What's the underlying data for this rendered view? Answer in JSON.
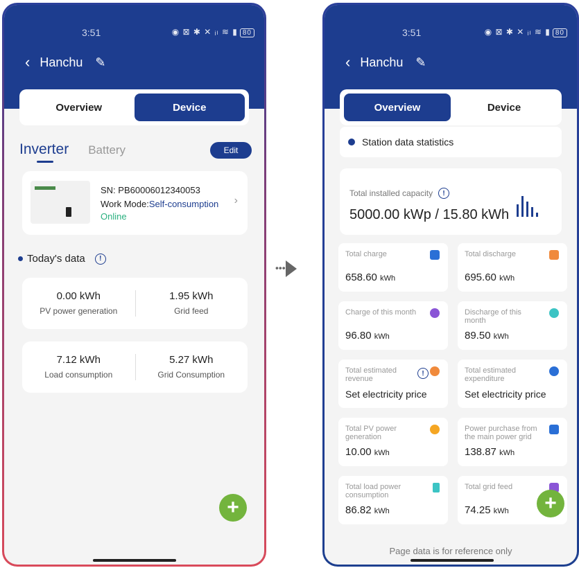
{
  "left": {
    "status": {
      "time": "3:51",
      "icons": "◉ ⊠ ✱ ✕ ᵢₗ ≋ ▮",
      "battery": "80"
    },
    "nav": {
      "back": "‹",
      "title": "Hanchu",
      "edit_icon": "✎"
    },
    "segment": {
      "overview": "Overview",
      "device": "Device"
    },
    "tabs": {
      "inverter": "Inverter",
      "battery": "Battery",
      "edit": "Edit"
    },
    "inverter": {
      "sn": "SN: PB60006012340053",
      "work_mode_label": "Work Mode:",
      "work_mode": "Self-consumption",
      "status": "Online"
    },
    "today": {
      "title": "Today's data"
    },
    "stats": [
      {
        "value": "0.00 kWh",
        "label": "PV power generation"
      },
      {
        "value": "1.95 kWh",
        "label": "Grid feed"
      },
      {
        "value": "7.12 kWh",
        "label": "Load consumption"
      },
      {
        "value": "5.27 kWh",
        "label": "Grid Consumption"
      }
    ],
    "fab": "+"
  },
  "arrow": "•••",
  "right": {
    "status": {
      "time": "3:51",
      "icons": "◉ ⊠ ✱ ✕ ᵢₗ ≋ ▮",
      "battery": "80"
    },
    "nav": {
      "back": "‹",
      "title": "Hanchu",
      "edit_icon": "✎"
    },
    "segment": {
      "overview": "Overview",
      "device": "Device"
    },
    "section_title": "Station data statistics",
    "capacity": {
      "label": "Total installed capacity",
      "value": "5000.00 kWp / 15.80 kWh"
    },
    "cards": [
      {
        "label": "Total charge",
        "value": "658.60",
        "unit": "kWh",
        "color": "#2a6fd6"
      },
      {
        "label": "Total discharge",
        "value": "695.60",
        "unit": "kWh",
        "color": "#f08a3c"
      },
      {
        "label": "Charge of this month",
        "value": "96.80",
        "unit": "kWh",
        "color": "#8a55d6"
      },
      {
        "label": "Discharge of this month",
        "value": "89.50",
        "unit": "kWh",
        "color": "#3cc4c4"
      },
      {
        "label": "Total estimated revenue",
        "value": "Set electricity price",
        "unit": "",
        "color": "#f08a3c"
      },
      {
        "label": "Total estimated expenditure",
        "value": "Set electricity price",
        "unit": "",
        "color": "#2a6fd6"
      },
      {
        "label": "Total PV power generation",
        "value": "10.00",
        "unit": "kWh",
        "color": "#f5a623"
      },
      {
        "label": "Power purchase from the main power grid",
        "value": "138.87",
        "unit": "kWh",
        "color": "#2a6fd6"
      },
      {
        "label": "Total load power consumption",
        "value": "86.82",
        "unit": "kWh",
        "color": "#3cc4c4"
      },
      {
        "label": "Total grid feed",
        "value": "74.25",
        "unit": "kWh",
        "color": "#8a55d6"
      }
    ],
    "footnote": "Page data is for reference only",
    "fab": "+"
  }
}
